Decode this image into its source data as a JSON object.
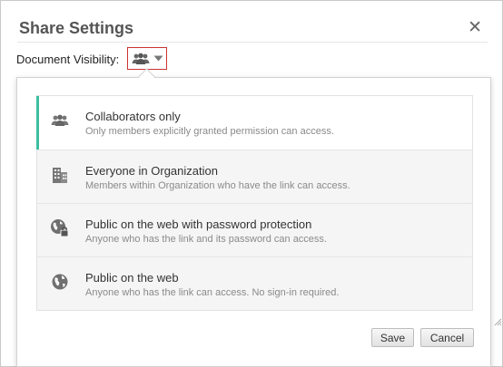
{
  "dialog": {
    "title": "Share Settings",
    "close_glyph": "✕"
  },
  "visibility": {
    "label": "Document Visibility:",
    "current_icon": "people-icon"
  },
  "options": [
    {
      "title": "Collaborators only",
      "description": "Only members explicitly granted permission can access.",
      "icon": "people-icon",
      "selected": true
    },
    {
      "title": "Everyone in Organization",
      "description": "Members within Organization who have the link can access.",
      "icon": "building-icon",
      "selected": false
    },
    {
      "title": "Public on the web with password protection",
      "description": "Anyone who has the link and its password can access.",
      "icon": "globe-lock-icon",
      "selected": false
    },
    {
      "title": "Public on the web",
      "description": "Anyone who has the link can access. No sign-in required.",
      "icon": "globe-icon",
      "selected": false
    }
  ],
  "buttons": {
    "save": "Save",
    "cancel": "Cancel"
  },
  "colors": {
    "selected_accent": "#3cbf9f",
    "trigger_border": "#cc3333"
  }
}
